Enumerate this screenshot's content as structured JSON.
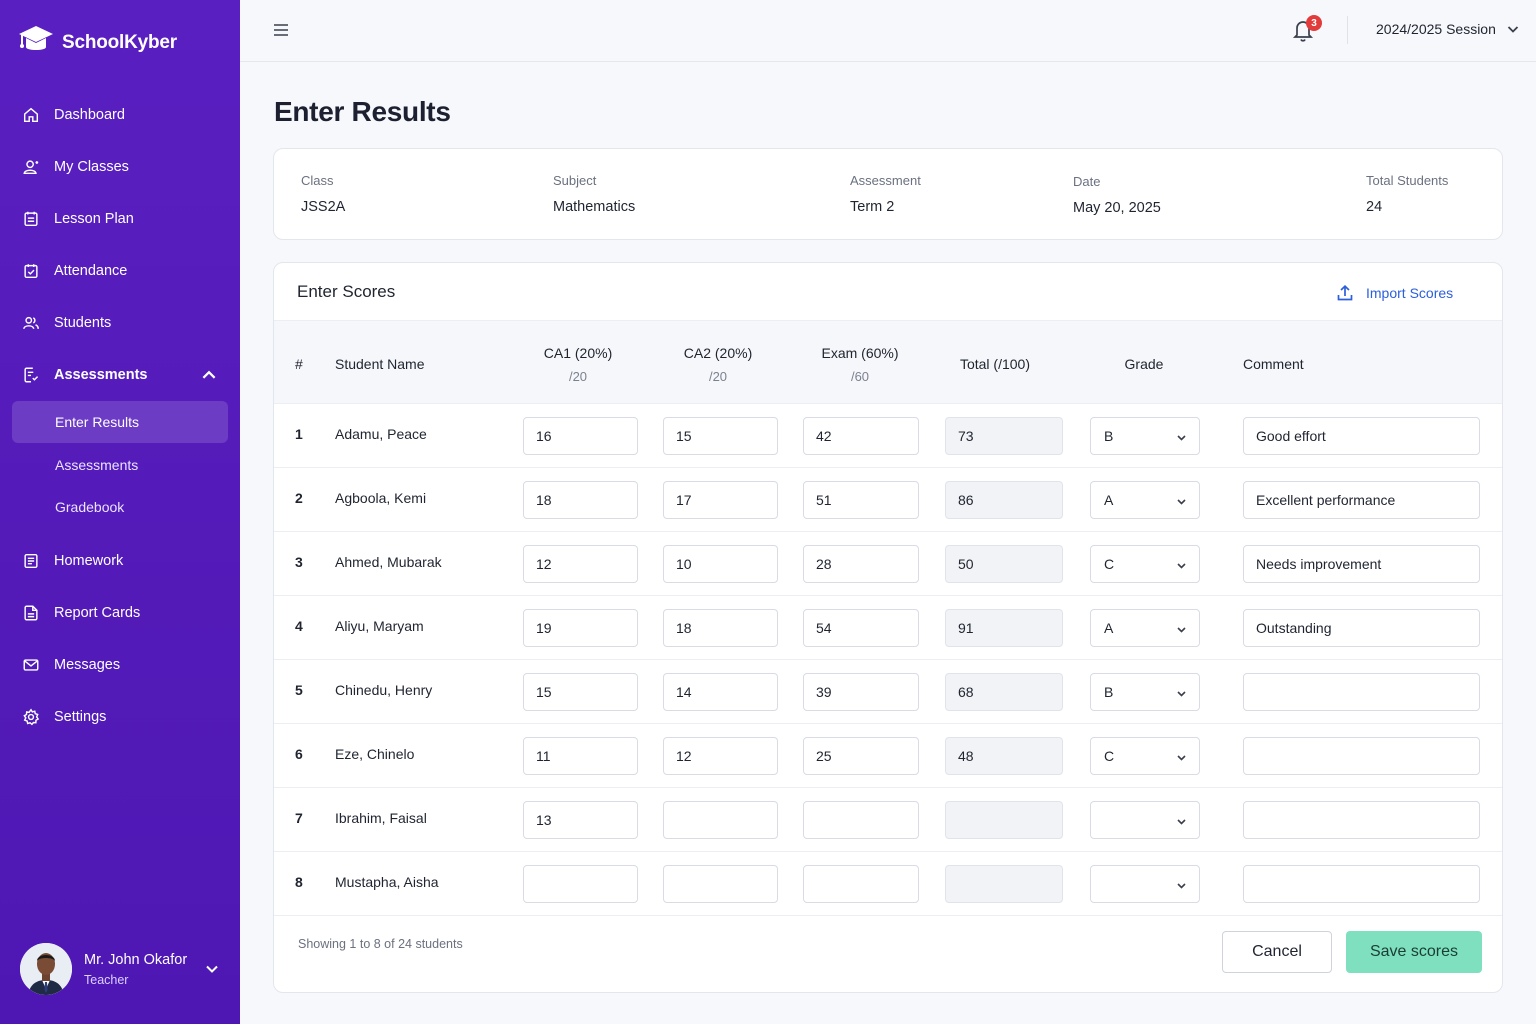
{
  "brand": {
    "name": "SchoolKyber"
  },
  "sidebar": {
    "items": [
      {
        "label": "Dashboard",
        "icon": "home-icon"
      },
      {
        "label": "My Classes",
        "icon": "class-icon"
      },
      {
        "label": "Lesson Plan",
        "icon": "lesson-plan-icon"
      },
      {
        "label": "Attendance",
        "icon": "attendance-icon"
      },
      {
        "label": "Students",
        "icon": "students-icon"
      },
      {
        "label": "Assessments",
        "icon": "assessments-icon",
        "expanded": true
      },
      {
        "label": "Homework",
        "icon": "homework-icon"
      },
      {
        "label": "Report Cards",
        "icon": "report-card-icon"
      },
      {
        "label": "Messages",
        "icon": "mail-icon"
      },
      {
        "label": "Settings",
        "icon": "gear-icon"
      }
    ],
    "sub_items": [
      {
        "label": "Enter Results",
        "active": true
      },
      {
        "label": "Assessments",
        "active": false
      },
      {
        "label": "Gradebook",
        "active": false
      }
    ]
  },
  "user": {
    "name": "Mr. John Okafor",
    "role": "Teacher"
  },
  "topbar": {
    "notification_count": "3",
    "session": "2024/2025 Session"
  },
  "page": {
    "title": "Enter Results"
  },
  "info": {
    "class_label": "Class",
    "class_value": "JSS2A",
    "subject_label": "Subject",
    "subject_value": "Mathematics",
    "assessment_label": "Assessment",
    "assessment_value": "Term 2",
    "date_label": "Date",
    "date_value": "May 20, 2025",
    "total_label": "Total Students",
    "total_value": "24"
  },
  "scores": {
    "title": "Enter Scores",
    "import_label": "Import Scores",
    "headers": {
      "index": "#",
      "name": "Student Name",
      "ca1": "CA1 (20%)",
      "ca1_sub": "/20",
      "ca2": "CA2 (20%)",
      "ca2_sub": "/20",
      "exam": "Exam (60%)",
      "exam_sub": "/60",
      "total": "Total (/100)",
      "grade": "Grade",
      "comment": "Comment"
    },
    "rows": [
      {
        "idx": "1",
        "name": "Adamu, Peace",
        "ca1": "16",
        "ca2": "15",
        "exam": "42",
        "total": "73",
        "grade": "B",
        "comment": "Good effort"
      },
      {
        "idx": "2",
        "name": "Agboola, Kemi",
        "ca1": "18",
        "ca2": "17",
        "exam": "51",
        "total": "86",
        "grade": "A",
        "comment": "Excellent performance"
      },
      {
        "idx": "3",
        "name": "Ahmed, Mubarak",
        "ca1": "12",
        "ca2": "10",
        "exam": "28",
        "total": "50",
        "grade": "C",
        "comment": "Needs improvement"
      },
      {
        "idx": "4",
        "name": "Aliyu, Maryam",
        "ca1": "19",
        "ca2": "18",
        "exam": "54",
        "total": "91",
        "grade": "A",
        "comment": "Outstanding"
      },
      {
        "idx": "5",
        "name": "Chinedu, Henry",
        "ca1": "15",
        "ca2": "14",
        "exam": "39",
        "total": "68",
        "grade": "B",
        "comment": ""
      },
      {
        "idx": "6",
        "name": "Eze, Chinelo",
        "ca1": "11",
        "ca2": "12",
        "exam": "25",
        "total": "48",
        "grade": "C",
        "comment": ""
      },
      {
        "idx": "7",
        "name": "Ibrahim, Faisal",
        "ca1": "13",
        "ca2": "",
        "exam": "",
        "total": "",
        "grade": "",
        "comment": ""
      },
      {
        "idx": "8",
        "name": "Mustapha, Aisha",
        "ca1": "",
        "ca2": "",
        "exam": "",
        "total": "",
        "grade": "",
        "comment": ""
      }
    ],
    "footer": "Showing 1 to 8 of 24 students",
    "cancel_label": "Cancel",
    "save_label": "Save scores"
  },
  "colors": {
    "sidebar": "#5a1fc0",
    "accent": "#2c5fdc",
    "save": "#7fe0bf",
    "badge": "#e23b3b"
  }
}
